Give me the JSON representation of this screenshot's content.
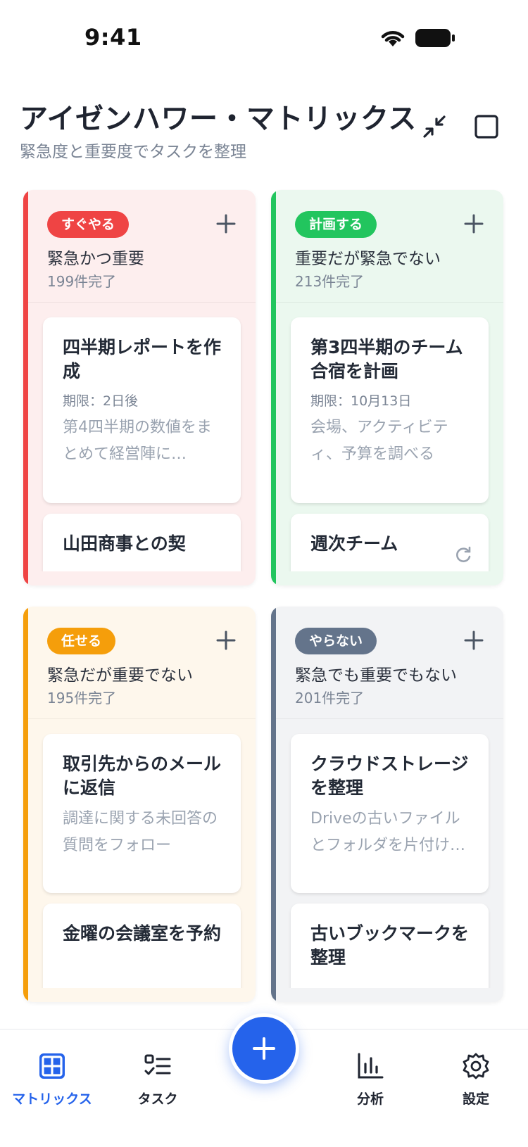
{
  "status_bar": {
    "time": "9:41"
  },
  "header": {
    "title": "アイゼンハワー・マトリックス",
    "subtitle": "緊急度と重要度でタスクを整理"
  },
  "quadrants": [
    {
      "badge": "すぐやる",
      "title": "緊急かつ重要",
      "count": "199件完了",
      "color": "#ef4444",
      "tasks": [
        {
          "title": "四半期レポートを作成",
          "due": "期限：2日後",
          "desc": "第4四半期の数値をまとめて経営陣に…"
        },
        {
          "title": "山田商事との契"
        }
      ]
    },
    {
      "badge": "計画する",
      "title": "重要だが緊急でない",
      "count": "213件完了",
      "color": "#22c55e",
      "tasks": [
        {
          "title": "第3四半期のチーム合宿を計画",
          "due": "期限：10月13日",
          "desc": "会場、アクティビティ、予算を調べる"
        },
        {
          "title": "週次チーム"
        }
      ]
    },
    {
      "badge": "任せる",
      "title": "緊急だが重要でない",
      "count": "195件完了",
      "color": "#f59e0b",
      "tasks": [
        {
          "title": "取引先からのメールに返信",
          "desc": "調達に関する未回答の質問をフォロー"
        },
        {
          "title": "金曜の会議室を予約"
        }
      ]
    },
    {
      "badge": "やらない",
      "title": "緊急でも重要でもない",
      "count": "201件完了",
      "color": "#64748b",
      "tasks": [
        {
          "title": "クラウドストレージを整理",
          "desc": "Driveの古いファイルとフォルダを片付け…"
        },
        {
          "title": "古いブックマークを整理"
        }
      ]
    }
  ],
  "nav": {
    "matrix": "マトリックス",
    "tasks": "タスク",
    "analytics": "分析",
    "settings": "設定",
    "active_color": "#2563eb"
  },
  "icons": {
    "collapse": "collapse-icon",
    "square": "square-icon",
    "add": "plus-icon",
    "repeat": "repeat-icon"
  }
}
